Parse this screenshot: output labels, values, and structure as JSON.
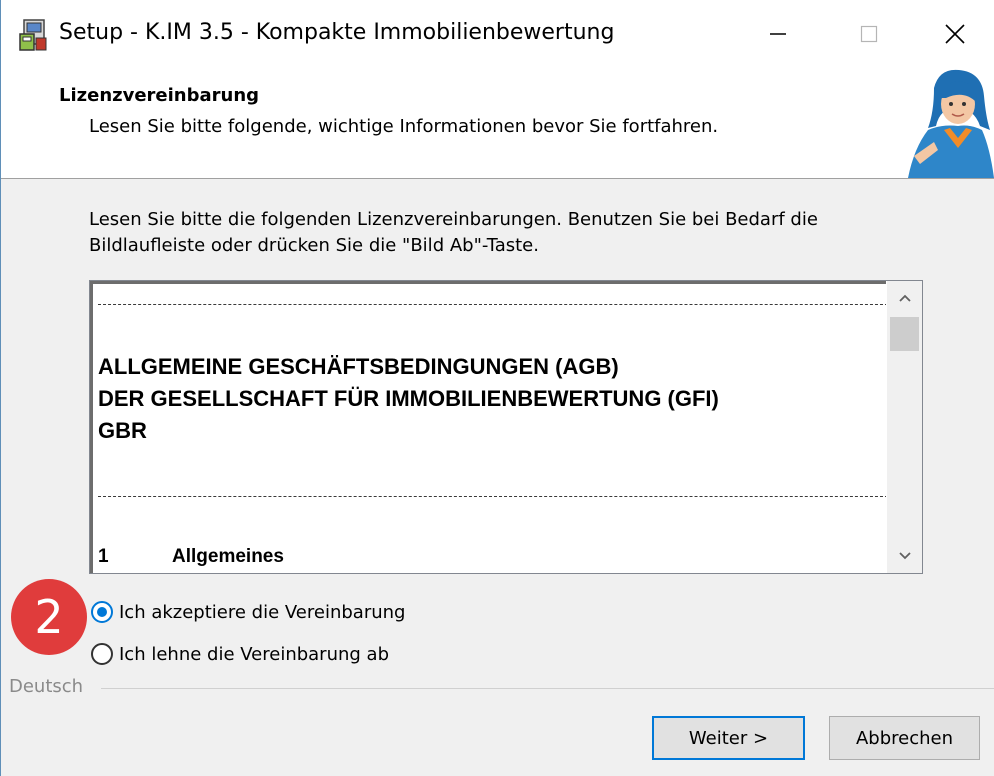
{
  "window": {
    "title": "Setup - K.IM 3.5 - Kompakte Immobilienbewertung"
  },
  "header": {
    "title": "Lizenzvereinbarung",
    "subtitle": "Lesen Sie bitte folgende, wichtige Informationen bevor Sie fortfahren."
  },
  "body": {
    "instructions": "Lesen Sie bitte die folgenden Lizenzvereinbarungen. Benutzen Sie bei Bedarf die Bildlaufleiste oder drücken Sie die \"Bild Ab\"-Taste."
  },
  "license": {
    "heading_lines": [
      "ALLGEMEINE GESCHÄFTSBEDINGUNGEN (AGB)",
      "DER GESELLSCHAFT FÜR IMMOBILIENBEWERTUNG (GFI)",
      "GBR"
    ],
    "section_number": "1",
    "section_title": "Allgemeines"
  },
  "options": {
    "accept_label": "Ich akzeptiere die Vereinbarung",
    "decline_label": "Ich lehne die Vereinbarung ab",
    "selected": "accept"
  },
  "annotation": {
    "step_number": "2"
  },
  "footer": {
    "language": "Deutsch",
    "next_label": "Weiter >",
    "cancel_label": "Abbrechen"
  },
  "colors": {
    "accent": "#0078d7",
    "badge": "#e03c3c",
    "dialog_bg": "#f0f0f0"
  }
}
